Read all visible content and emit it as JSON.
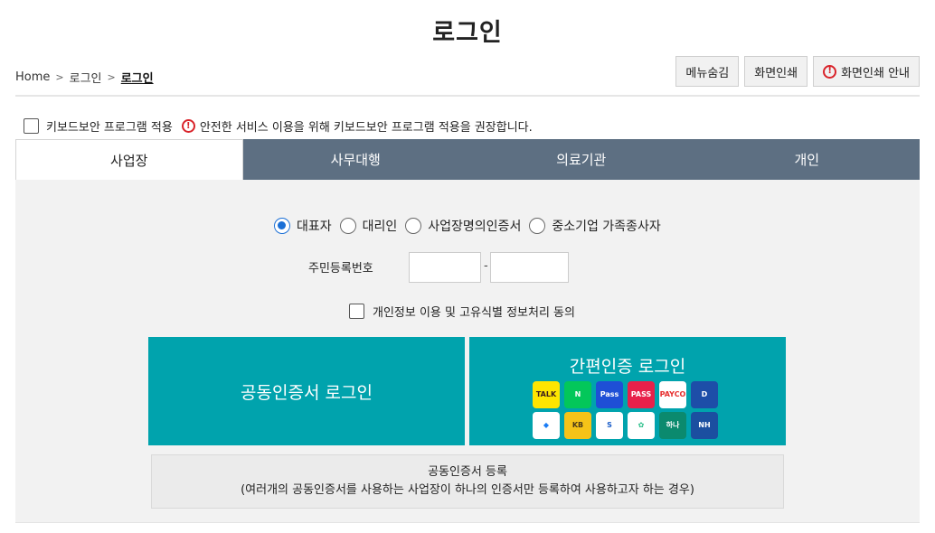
{
  "page": {
    "title": "로그인"
  },
  "breadcrumb": {
    "home": "Home",
    "level1": "로그인",
    "current": "로그인"
  },
  "top_buttons": {
    "hide_menu": "메뉴숨김",
    "print": "화면인쇄",
    "print_guide": "화면인쇄 안내"
  },
  "keyboard_security": {
    "label": "키보드보안 프로그램 적용",
    "notice": "안전한 서비스 이용을 위해 키보드보안 프로그램 적용을 권장합니다."
  },
  "tabs": [
    {
      "label": "사업장",
      "active": true
    },
    {
      "label": "사무대행",
      "active": false
    },
    {
      "label": "의료기관",
      "active": false
    },
    {
      "label": "개인",
      "active": false
    }
  ],
  "user_types": [
    {
      "label": "대표자",
      "selected": true
    },
    {
      "label": "대리인",
      "selected": false
    },
    {
      "label": "사업장명의인증서",
      "selected": false
    },
    {
      "label": "중소기업 가족종사자",
      "selected": false
    }
  ],
  "rrn": {
    "label": "주민등록번호",
    "separator": "-",
    "front_value": "",
    "back_value": ""
  },
  "privacy_agree": {
    "label": "개인정보 이용 및 고유식별 정보처리 동의"
  },
  "login": {
    "cert_button": "공동인증서 로그인",
    "simple_button": "간편인증 로그인",
    "simple_auth_providers": [
      {
        "name": "kakao-talk-icon",
        "text": "TALK",
        "bg": "#fee500",
        "fg": "#3c1e1e"
      },
      {
        "name": "naver-icon",
        "text": "N",
        "bg": "#03c75a",
        "fg": "#ffffff"
      },
      {
        "name": "samsung-pass-icon",
        "text": "Pass",
        "bg": "#1e4fd6",
        "fg": "#ffffff"
      },
      {
        "name": "pass-icon",
        "text": "PASS",
        "bg": "#e8204a",
        "fg": "#ffffff"
      },
      {
        "name": "payco-icon",
        "text": "PAYCO",
        "bg": "#ffffff",
        "fg": "#e62e2e"
      },
      {
        "name": "digital-id-icon",
        "text": "D",
        "bg": "#1d4ea8",
        "fg": "#ffffff"
      },
      {
        "name": "toss-icon",
        "text": "◆",
        "bg": "#ffffff",
        "fg": "#1a7cf5"
      },
      {
        "name": "kb-icon",
        "text": "KB",
        "bg": "#f5c318",
        "fg": "#4a3a1a"
      },
      {
        "name": "shinhan-icon",
        "text": "S",
        "bg": "#ffffff",
        "fg": "#1a5dc9"
      },
      {
        "name": "banksalad-icon",
        "text": "✿",
        "bg": "#ffffff",
        "fg": "#2bbf8a"
      },
      {
        "name": "hana-icon",
        "text": "하나",
        "bg": "#0b8a6e",
        "fg": "#ffffff"
      },
      {
        "name": "nh-icon",
        "text": "NH",
        "bg": "#1b4fa0",
        "fg": "#ffffff"
      }
    ]
  },
  "register": {
    "title": "공동인증서 등록",
    "description": "(여러개의 공동인증서를 사용하는 사업장이 하나의 인증서만 등록하여 사용하고자 하는 경우)"
  }
}
